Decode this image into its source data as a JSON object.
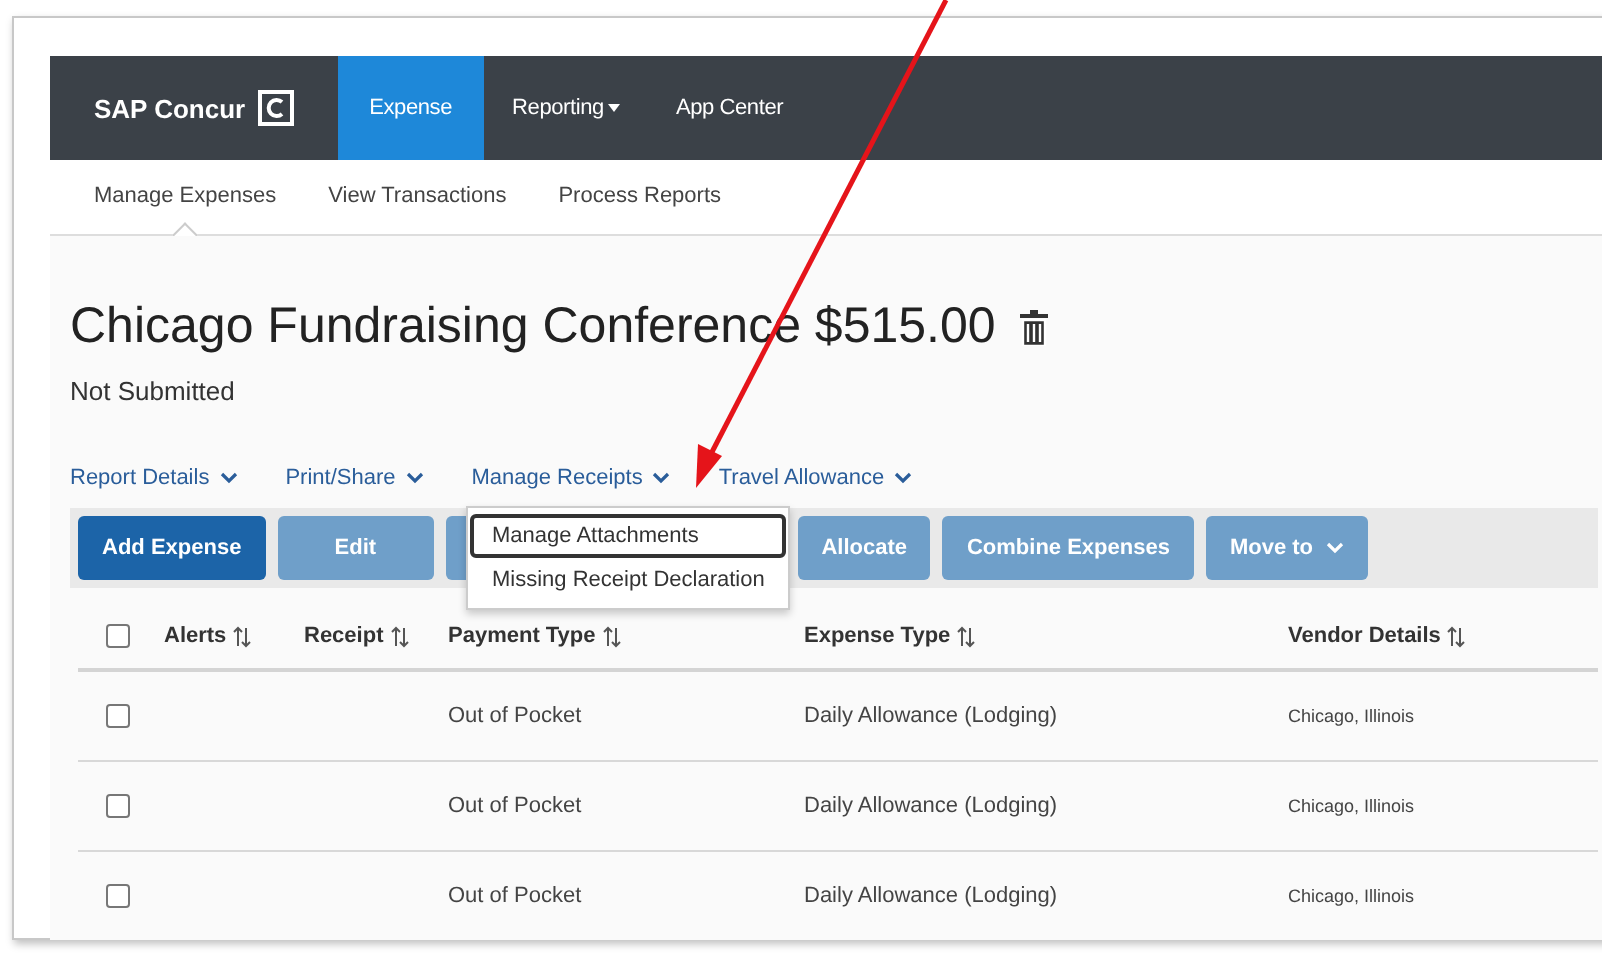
{
  "nav": {
    "brand": "SAP Concur",
    "items": [
      {
        "label": "Expense",
        "selected": true,
        "dropdown": false
      },
      {
        "label": "Reporting",
        "selected": false,
        "dropdown": true
      },
      {
        "label": "App Center",
        "selected": false,
        "dropdown": false
      }
    ]
  },
  "subnav": [
    {
      "label": "Manage Expenses",
      "selected": true
    },
    {
      "label": "View Transactions",
      "selected": false
    },
    {
      "label": "Process Reports",
      "selected": false
    }
  ],
  "report": {
    "title": "Chicago Fundraising Conference $515.00",
    "status": "Not Submitted"
  },
  "menus": [
    "Report Details",
    "Print/Share",
    "Manage Receipts",
    "Travel Allowance"
  ],
  "toolbar": [
    {
      "label": "Add Expense",
      "disabled": false,
      "dropdown": false
    },
    {
      "label": "Edit",
      "disabled": true,
      "dropdown": false
    },
    {
      "disabled": true,
      "dropdown": false
    },
    {
      "label": "Allocate",
      "disabled": true,
      "dropdown": false
    },
    {
      "label": "Combine Expenses",
      "disabled": true,
      "dropdown": false
    },
    {
      "label": "Move to",
      "disabled": true,
      "dropdown": true
    }
  ],
  "dropdown": [
    {
      "label": "Manage Attachments",
      "selected": true
    },
    {
      "label": "Missing Receipt Declaration",
      "selected": false
    }
  ],
  "table": {
    "all_checked": false,
    "columns": [
      "Alerts",
      "Receipt",
      "Payment Type",
      "Expense Type",
      "Vendor Details"
    ],
    "rows": [
      {
        "checked": false,
        "payment_type": "Out of Pocket",
        "expense_type": "Daily Allowance (Lodging)",
        "vendor": "Chicago, Illinois"
      },
      {
        "checked": false,
        "payment_type": "Out of Pocket",
        "expense_type": "Daily Allowance (Lodging)",
        "vendor": "Chicago, Illinois"
      },
      {
        "checked": false,
        "payment_type": "Out of Pocket",
        "expense_type": "Daily Allowance (Lodging)",
        "vendor": "Chicago, Illinois"
      }
    ]
  }
}
